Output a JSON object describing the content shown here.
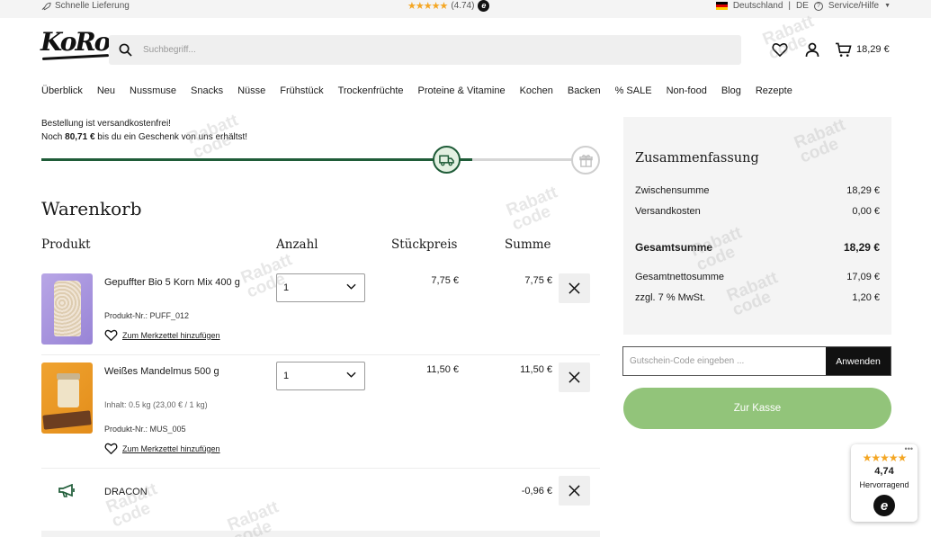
{
  "topbar": {
    "shipping_note": "Schnelle Lieferung",
    "rating_text": "(4.74)",
    "country": "Deutschland",
    "separator": "|",
    "language": "DE",
    "service": "Service/Hilfe"
  },
  "header": {
    "logo": "KoRo",
    "search_placeholder": "Suchbegriff...",
    "cart_total": "18,29 €"
  },
  "nav": {
    "items": [
      "Überblick",
      "Neu",
      "Nussmuse",
      "Snacks",
      "Nüsse",
      "Frühstück",
      "Trockenfrüchte",
      "Proteine & Vitamine",
      "Kochen",
      "Backen",
      "% SALE",
      "Non-food",
      "Blog",
      "Rezepte"
    ]
  },
  "shipping": {
    "line1": "Bestellung ist versandkostenfrei!",
    "line2_prefix": "Noch",
    "line2_amount": "80,71 €",
    "line2_suffix": "bis du ein Geschenk von uns erhältst!",
    "progress": 0.79
  },
  "cart": {
    "title": "Warenkorb",
    "columns": {
      "product": "Produkt",
      "quantity": "Anzahl",
      "unit_price": "Stückpreis",
      "total": "Summe"
    },
    "wishlist_label": "Zum Merkzettel hinzufügen",
    "items": [
      {
        "name": "Gepuffter Bio 5 Korn Mix 400 g",
        "sku": "Produkt-Nr.: PUFF_012",
        "quantity": "1",
        "unit_price": "7,75 €",
        "total": "7,75 €"
      },
      {
        "name": "Weißes Mandelmus 500 g",
        "content": "Inhalt: 0.5 kg (23,00 € / 1 kg)",
        "sku": "Produkt-Nr.: MUS_005",
        "quantity": "1",
        "unit_price": "11,50 €",
        "total": "11,50 €"
      }
    ],
    "promo": {
      "code": "DRACON",
      "amount": "-0,96 €"
    }
  },
  "summary": {
    "title": "Zusammenfassung",
    "subtotal_label": "Zwischensumme",
    "subtotal": "18,29 €",
    "shipping_label": "Versandkosten",
    "shipping": "0,00 €",
    "total_label": "Gesamtsumme",
    "total": "18,29 €",
    "net_label": "Gesamtnettosumme",
    "net": "17,09 €",
    "vat_label": "zzgl. 7 % MwSt.",
    "vat": "1,20 €",
    "coupon_placeholder": "Gutschein-Code eingeben ...",
    "apply_label": "Anwenden",
    "checkout_label": "Zur Kasse"
  },
  "trust_badge": {
    "score": "4,74",
    "rating": "Hervorragend"
  },
  "watermark": {
    "line1": "Rabatt",
    "line2": "code"
  },
  "colors": {
    "accent_green": "#1f5c38",
    "checkout_green": "#92c47a",
    "star_orange": "#f4a623"
  }
}
